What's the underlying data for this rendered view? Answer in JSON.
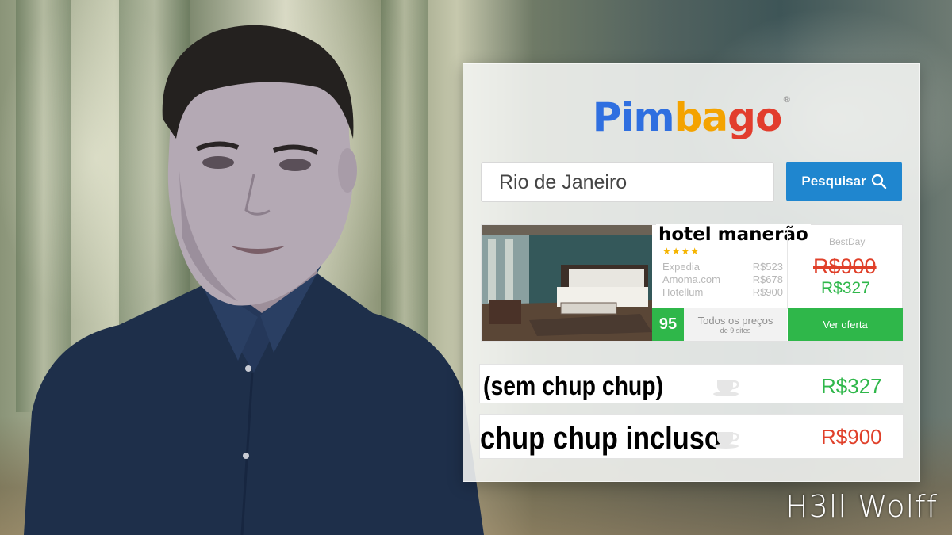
{
  "brand": {
    "logo_letters": [
      {
        "ch": "P",
        "color": "#2f6fe0"
      },
      {
        "ch": "i",
        "color": "#2f6fe0"
      },
      {
        "ch": "m",
        "color": "#2f6fe0"
      },
      {
        "ch": "b",
        "color": "#f4a300"
      },
      {
        "ch": "a",
        "color": "#f4a300"
      },
      {
        "ch": "g",
        "color": "#e23d2d"
      },
      {
        "ch": "o",
        "color": "#e23d2d"
      }
    ],
    "registered_mark": "®"
  },
  "search": {
    "value": "Rio de Janeiro",
    "button_label": "Pesquisar"
  },
  "hotel": {
    "name": "hotel manerão",
    "stars": "★★★★",
    "providers": [
      {
        "name": "Expedia",
        "price": "R$523"
      },
      {
        "name": "Amoma.com",
        "price": "R$678"
      },
      {
        "name": "Hotellum",
        "price": "R$900"
      }
    ],
    "featured_provider": "BestDay",
    "old_price": "R$900",
    "new_price": "R$327",
    "score": "95",
    "all_prices_line1": "Todos os preços",
    "all_prices_line2": "de 9 sites",
    "cta": "Ver oferta"
  },
  "options": [
    {
      "label": "(sem chup chup)",
      "icon": "coffee-cup-icon",
      "price": "R$327",
      "price_color": "#2fb74a"
    },
    {
      "label": "chup chup incluso",
      "icon": "coffee-cup-icon",
      "price": "R$900",
      "price_color": "#e0402a"
    }
  ],
  "watermark": "H3ll Wolff"
}
